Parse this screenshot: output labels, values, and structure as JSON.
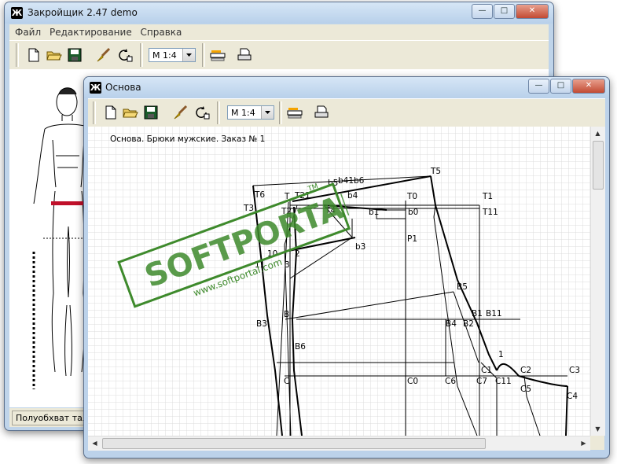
{
  "main_window": {
    "title": "Закройщик 2.47 demo",
    "menu": [
      "Файл",
      "Редактирование",
      "Справка"
    ],
    "scale_value": "M 1:4",
    "status_text": "Полуобхват талии"
  },
  "child_window": {
    "title": "Основа",
    "scale_value": "M 1:4",
    "drawing_caption": "Основа. Брюки мужские. Заказ № 1"
  },
  "watermark": {
    "brand": "SOFTPORTAL",
    "url": "www.softportal.com",
    "tm": "TM",
    "color": "#3e8a2c"
  },
  "pattern_labels": [
    "T5",
    "T6",
    "T",
    "T21",
    "b5",
    "b41",
    "b6",
    "b4",
    "T0",
    "T1",
    "T3",
    "T2",
    "T4",
    "b1",
    "b0",
    "T11",
    "P1",
    "b3",
    "10",
    "2",
    "11",
    "3",
    "B5",
    "B",
    "B1",
    "B11",
    "B3",
    "B4",
    "B2",
    "B6",
    "1",
    "C1",
    "C2",
    "C3",
    "C",
    "C0",
    "C6",
    "C7",
    "C11",
    "C5",
    "C4"
  ],
  "icons": {
    "toolbar": [
      "new-file-icon",
      "open-folder-icon",
      "save-disk-icon",
      "brush-icon",
      "rotate-icon",
      "ruler-settings-icon",
      "print-icon"
    ]
  }
}
